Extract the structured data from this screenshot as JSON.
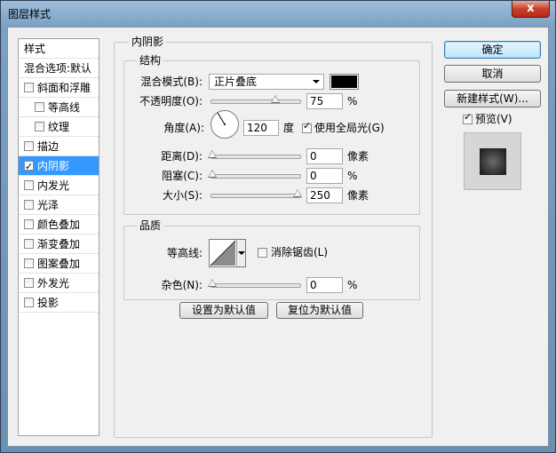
{
  "window": {
    "title": "图层样式",
    "close_label": "x"
  },
  "styles": {
    "header": "样式",
    "blend_options": "混合选项:默认",
    "items": [
      {
        "label": "斜面和浮雕",
        "checked": false,
        "indent": false
      },
      {
        "label": "等高线",
        "checked": false,
        "indent": true
      },
      {
        "label": "纹理",
        "checked": false,
        "indent": true
      },
      {
        "label": "描边",
        "checked": false,
        "indent": false
      },
      {
        "label": "内阴影",
        "checked": true,
        "indent": false,
        "selected": true
      },
      {
        "label": "内发光",
        "checked": false,
        "indent": false
      },
      {
        "label": "光泽",
        "checked": false,
        "indent": false
      },
      {
        "label": "颜色叠加",
        "checked": false,
        "indent": false
      },
      {
        "label": "渐变叠加",
        "checked": false,
        "indent": false
      },
      {
        "label": "图案叠加",
        "checked": false,
        "indent": false
      },
      {
        "label": "外发光",
        "checked": false,
        "indent": false
      },
      {
        "label": "投影",
        "checked": false,
        "indent": false
      }
    ]
  },
  "inner_shadow": {
    "title": "内阴影",
    "structure": {
      "title": "结构",
      "blend_mode_label": "混合模式(B):",
      "blend_mode_value": "正片叠底",
      "color": "#000000",
      "opacity_label": "不透明度(O):",
      "opacity_value": "75",
      "opacity_unit": "%",
      "angle_label": "角度(A):",
      "angle_value": "120",
      "angle_unit": "度",
      "global_light_label": "使用全局光(G)",
      "global_light_checked": true,
      "distance_label": "距离(D):",
      "distance_value": "0",
      "distance_unit": "像素",
      "choke_label": "阻塞(C):",
      "choke_value": "0",
      "choke_unit": "%",
      "size_label": "大小(S):",
      "size_value": "250",
      "size_unit": "像素"
    },
    "quality": {
      "title": "品质",
      "contour_label": "等高线:",
      "anti_alias_label": "消除锯齿(L)",
      "anti_alias_checked": false,
      "noise_label": "杂色(N):",
      "noise_value": "0",
      "noise_unit": "%"
    },
    "set_default_label": "设置为默认值",
    "reset_default_label": "复位为默认值"
  },
  "buttons": {
    "ok": "确定",
    "cancel": "取消",
    "new_style": "新建样式(W)...",
    "preview_label": "预览(V)",
    "preview_checked": true
  }
}
